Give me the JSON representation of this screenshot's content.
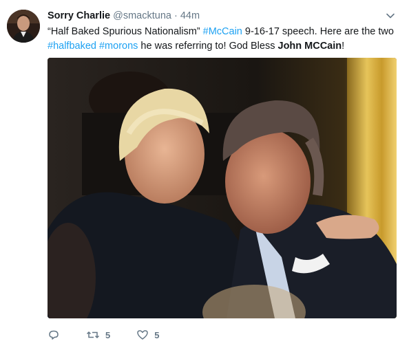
{
  "tweet": {
    "name": "Sorry Charlie",
    "handle": "@smacktuna",
    "dot": "·",
    "time": "44m",
    "text_segments": [
      {
        "text": "“Half Baked Spurious Nationalism” ",
        "style": "plain"
      },
      {
        "text": "#McCain",
        "style": "link"
      },
      {
        "text": "  9-16-17 speech. Here are the two ",
        "style": "plain"
      },
      {
        "text": "#halfbaked",
        "style": "link"
      },
      {
        "text": " ",
        "style": "plain"
      },
      {
        "text": "#morons",
        "style": "link"
      },
      {
        "text": " he was referring to! God Bless ",
        "style": "plain"
      },
      {
        "text": "John MCCain",
        "style": "bold"
      },
      {
        "text": "!",
        "style": "plain"
      }
    ]
  },
  "actions": {
    "reply_icon": "reply-icon",
    "retweet_icon": "retweet-icon",
    "retweet_count": "5",
    "like_icon": "heart-icon",
    "like_count": "5",
    "message_icon": "envelope-icon"
  },
  "colors": {
    "link": "#1da1f2",
    "secondary": "#657786",
    "text": "#14171a"
  }
}
